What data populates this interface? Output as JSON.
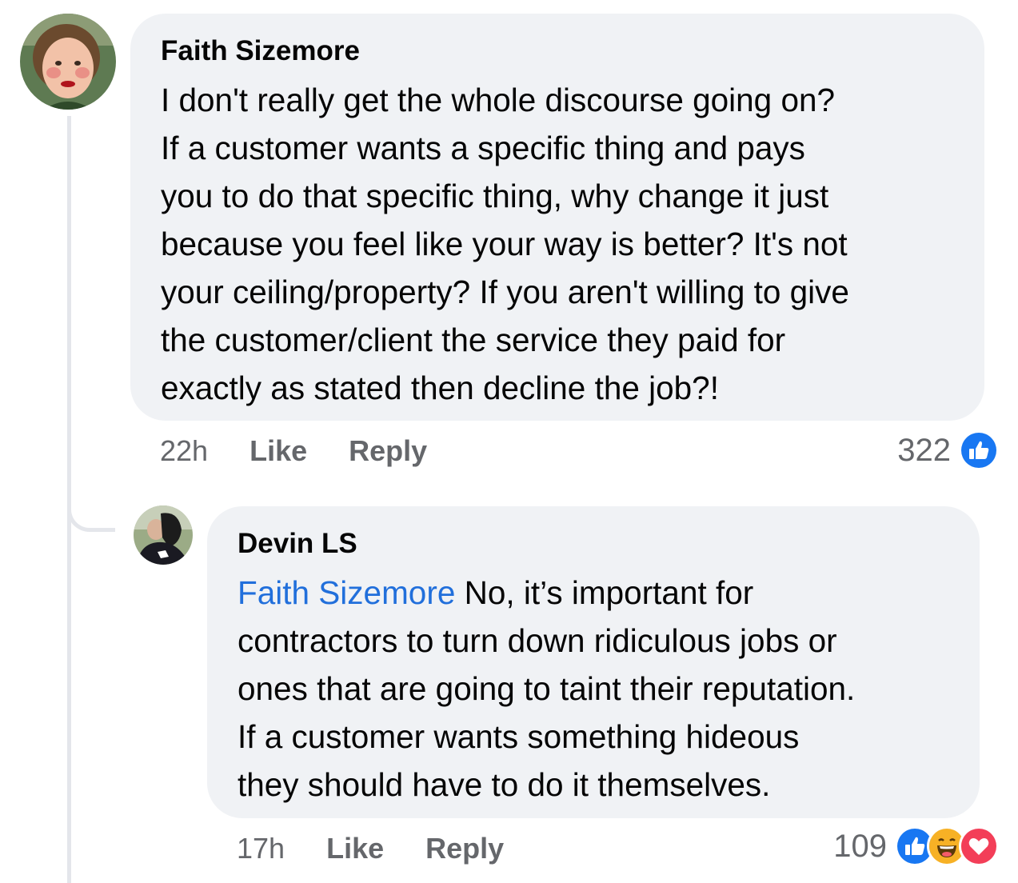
{
  "comments": [
    {
      "author": "Faith Sizemore",
      "text": "I don't really get the whole discourse going on?\nIf a customer wants a specific thing and pays\nyou to do that specific thing, why change it just\nbecause you feel like your way is better? It's not\nyour ceiling/property? If you aren't willing to give\nthe customer/client the service they paid for\nexactly as stated then decline the job?!",
      "time": "22h",
      "like_label": "Like",
      "reply_label": "Reply",
      "reaction_count": "322",
      "reactions": [
        "like-icon"
      ]
    },
    {
      "author": "Devin LS",
      "mention": "Faith Sizemore",
      "text_first": " No, it’s important for",
      "text": "contractors to turn down ridiculous jobs or\nones that are going to taint their reputation.\nIf a customer wants something hideous\nthey should have to do it themselves.",
      "time": "17h",
      "like_label": "Like",
      "reply_label": "Reply",
      "reaction_count": "109",
      "reactions": [
        "like-icon",
        "haha-icon",
        "love-icon"
      ]
    }
  ],
  "colors": {
    "bubble": "#f0f2f5",
    "mention": "#216fdb",
    "meta": "#65676b",
    "like": "#1877f2",
    "love": "#f33e58",
    "haha": "#f7b125"
  }
}
